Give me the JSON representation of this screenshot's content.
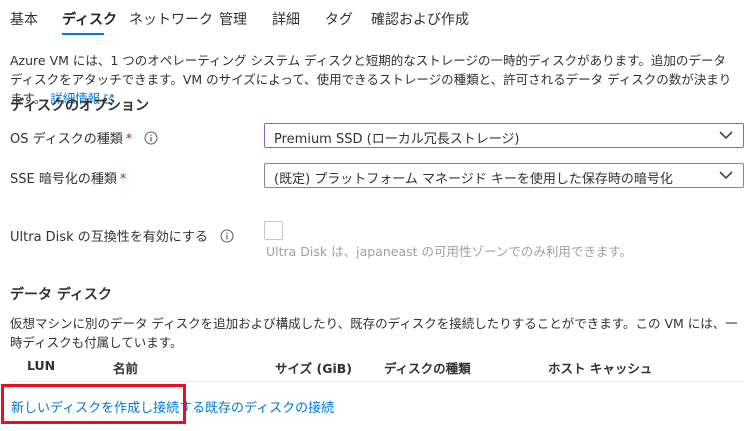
{
  "tabs": [
    {
      "label": "基本",
      "active": false
    },
    {
      "label": "ディスク",
      "active": true
    },
    {
      "label": "ネットワーク",
      "active": false
    },
    {
      "label": "管理",
      "active": false
    },
    {
      "label": "詳細",
      "active": false
    },
    {
      "label": "タグ",
      "active": false
    },
    {
      "label": "確認および作成",
      "active": false
    }
  ],
  "intro": {
    "line1": "Azure VM には、1 つのオペレーティング システム ディスクと短期的なストレージの一時的ディスクがあります。追加のデータ ディスクをアタッチできます。VM のサイズによって、使用できるストレージの種類と、許可されるデータ ディスクの数が決まります。",
    "link": "詳細情報"
  },
  "disk_options": {
    "title": "ディスクのオプション",
    "os_disk_type": {
      "label": "OS ディスクの種類",
      "required": "*",
      "value": "Premium SSD (ローカル冗長ストレージ)"
    },
    "sse_encryption": {
      "label": "SSE 暗号化の種類",
      "required": "*",
      "value": "(既定) プラットフォーム マネージド キーを使用した保存時の暗号化"
    },
    "ultra_disk": {
      "label": "Ultra Disk の互換性を有効にする",
      "checked": false,
      "helper": "Ultra Disk は、japaneast の可用性ゾーンでのみ利用できます。"
    }
  },
  "data_disks": {
    "title": "データ ディスク",
    "description": "仮想マシンに別のデータ ディスクを追加および構成したり、既存のディスクを接続したりすることができます。この VM には、一時ディスクも付属しています。",
    "columns": [
      "LUN",
      "名前",
      "サイズ (GiB)",
      "ディスクの種類",
      "ホスト キャッシュ"
    ],
    "create_link": "新しいディスクを作成し接続する",
    "attach_link": "既存のディスクの接続"
  },
  "colors": {
    "accent": "#0078d4",
    "required": "#a4262c",
    "highlight": "#e81123",
    "focus_border": "#8764b8"
  }
}
